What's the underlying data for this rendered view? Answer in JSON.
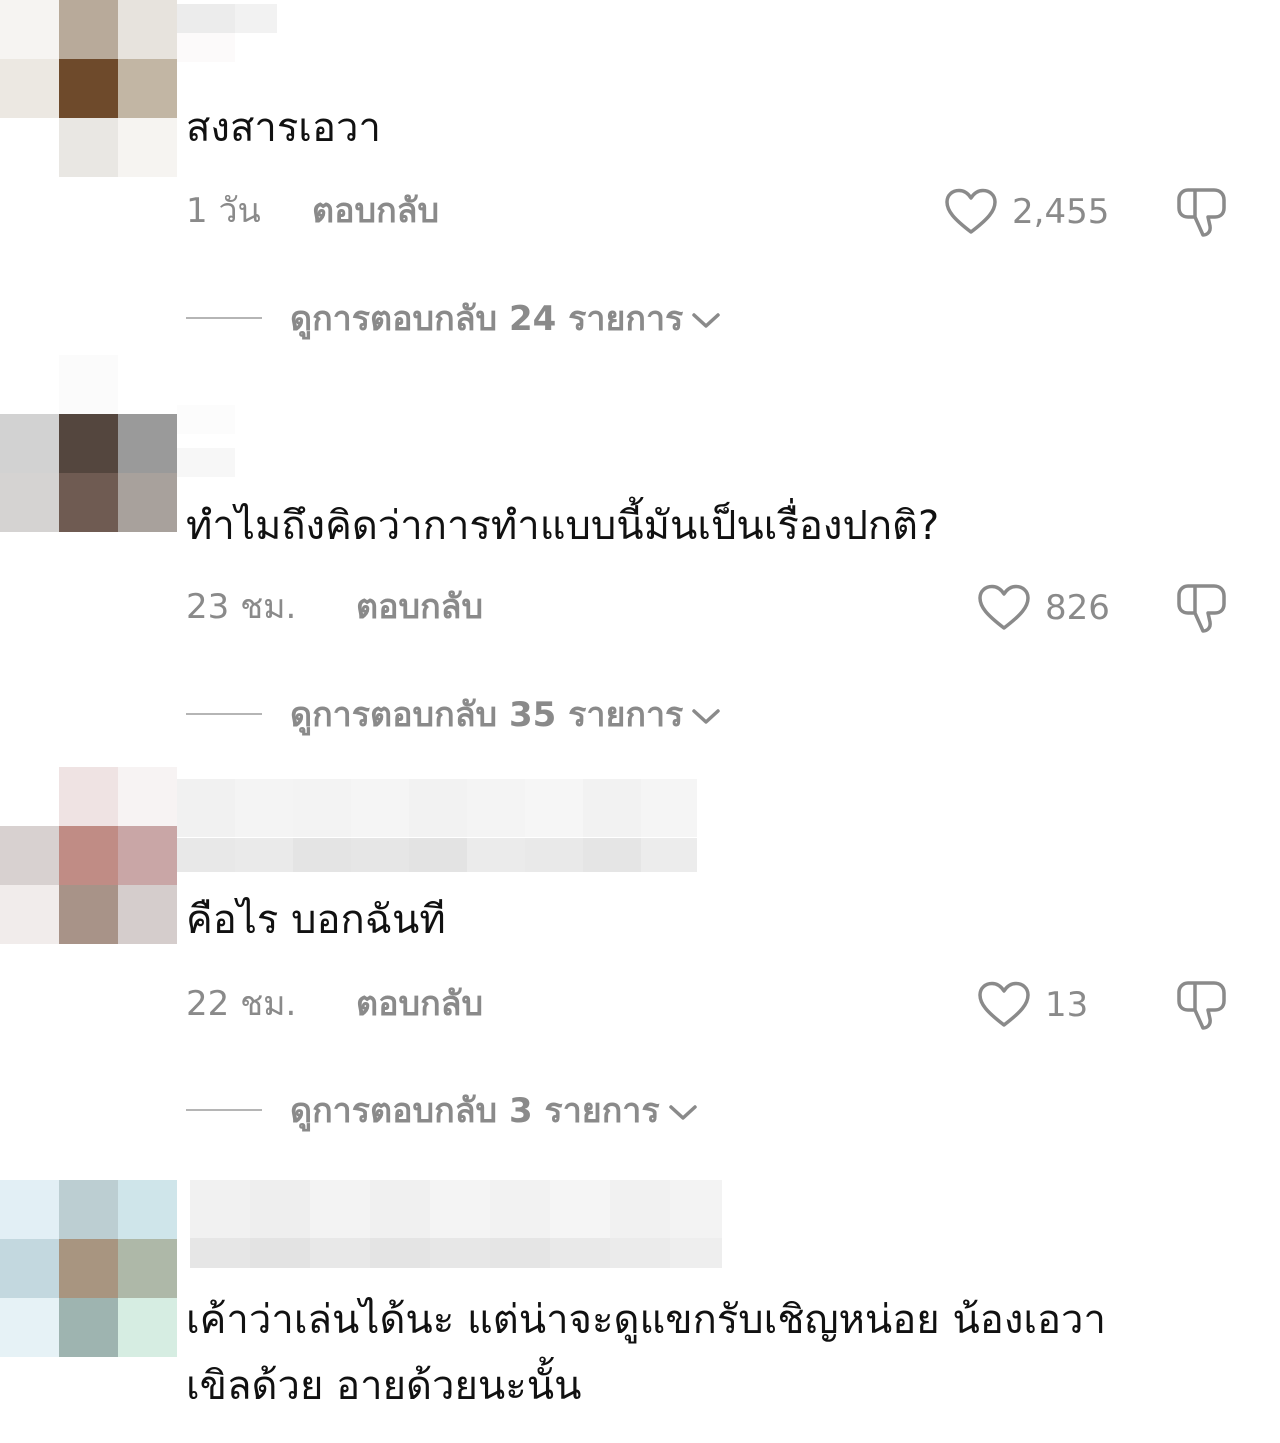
{
  "comments": [
    {
      "text": "สงสารเอวา",
      "time": "1 วัน",
      "reply": "ตอบกลับ",
      "likes": "2,455",
      "view_replies": "ดูการตอบกลับ 24 รายการ"
    },
    {
      "text": "ทำไมถึงคิดว่าการทำแบบนี้มันเป็นเรื่องปกติ?",
      "time": "23 ชม.",
      "reply": "ตอบกลับ",
      "likes": "826",
      "view_replies": "ดูการตอบกลับ 35 รายการ"
    },
    {
      "text": "คือไร บอกฉันที",
      "time": "22 ชม.",
      "reply": "ตอบกลับ",
      "likes": "13",
      "view_replies": "ดูการตอบกลับ 3 รายการ"
    },
    {
      "text_line1": "เค้าว่าเล่นได้นะ แต่น่าจะดูแขกรับเชิญหน่อย น้องเอวา",
      "text_line2": "เขิลด้วย อายด้วยนะนั้น"
    }
  ],
  "colors": {
    "meta_text": "#8a8a8a",
    "avatar1": [
      "#f6f4f2",
      "#b8aa9a",
      "#e7e3dd",
      "#ece8e2",
      "#6e4a2b",
      "#c2b6a4",
      "#ffffff",
      "#e9e7e3",
      "#f6f4f1"
    ],
    "avatar2": [
      "#ffffff",
      "#ffffff",
      "#ffffff",
      "#d2d2d2",
      "#54463e",
      "#9a9a9a",
      "#d5d3d2",
      "#6f5b52",
      "#a8a19c"
    ],
    "avatar3": [
      "#ffffff",
      "#efe3e3",
      "#f7f3f3",
      "#d8d1d0",
      "#c08c85",
      "#c9a6a6",
      "#f1eceb",
      "#a89388",
      "#d5cdcc"
    ],
    "avatar4": [
      "#e2eff5",
      "#bcced2",
      "#cfe5ea",
      "#c3d8df",
      "#a89580",
      "#aeb8a8",
      "#e6f2f6",
      "#9eb4b0",
      "#d6ede2"
    ]
  },
  "icons": {
    "like": "heart-outline-icon",
    "dislike": "thumbs-down-outline-icon",
    "chevron": "chevron-down-icon"
  }
}
